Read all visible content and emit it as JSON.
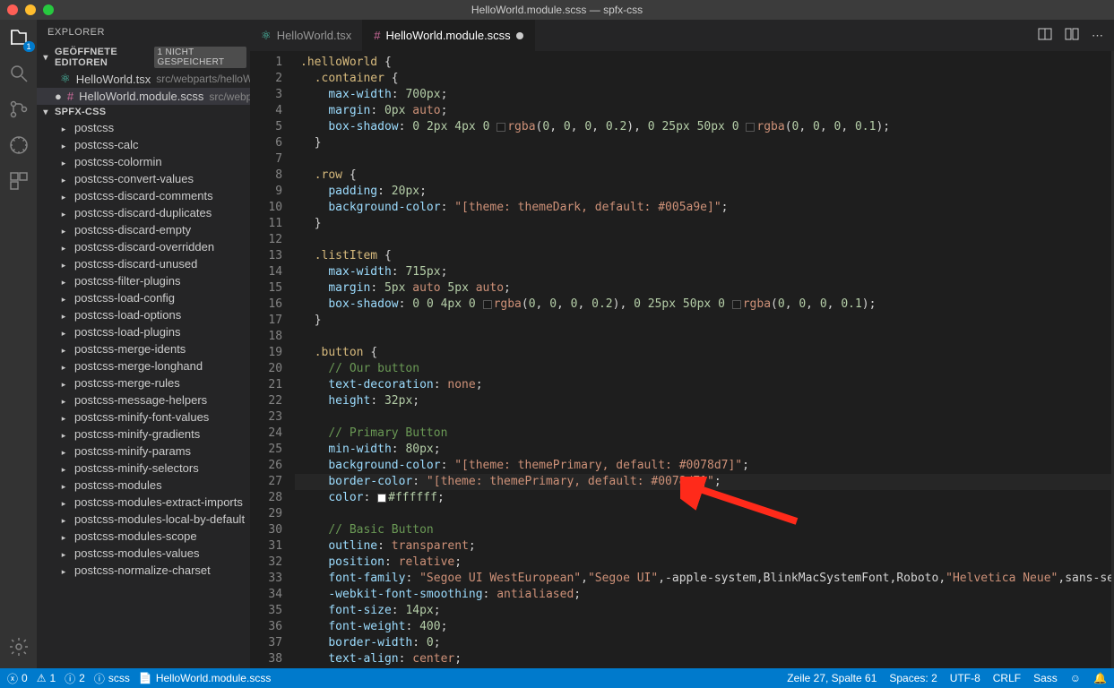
{
  "window": {
    "title": "HelloWorld.module.scss — spfx-css"
  },
  "activity_badge": "1",
  "sidebar": {
    "title": "EXPLORER",
    "open_editors_label": "GEÖFFNETE EDITOREN",
    "unsaved_badge": "1 NICHT GESPEICHERT",
    "project_label": "SPFX-CSS",
    "open_editors": [
      {
        "name": "HelloWorld.tsx",
        "path": "src/webparts/helloWor…",
        "dirty": false,
        "icon": "react"
      },
      {
        "name": "HelloWorld.module.scss",
        "path": "src/webpart…",
        "dirty": true,
        "icon": "sass"
      }
    ],
    "tree": [
      "postcss",
      "postcss-calc",
      "postcss-colormin",
      "postcss-convert-values",
      "postcss-discard-comments",
      "postcss-discard-duplicates",
      "postcss-discard-empty",
      "postcss-discard-overridden",
      "postcss-discard-unused",
      "postcss-filter-plugins",
      "postcss-load-config",
      "postcss-load-options",
      "postcss-load-plugins",
      "postcss-merge-idents",
      "postcss-merge-longhand",
      "postcss-merge-rules",
      "postcss-message-helpers",
      "postcss-minify-font-values",
      "postcss-minify-gradients",
      "postcss-minify-params",
      "postcss-minify-selectors",
      "postcss-modules",
      "postcss-modules-extract-imports",
      "postcss-modules-local-by-default",
      "postcss-modules-scope",
      "postcss-modules-values",
      "postcss-normalize-charset"
    ]
  },
  "tabs": [
    {
      "label": "HelloWorld.tsx",
      "icon": "react",
      "active": false,
      "dirty": false
    },
    {
      "label": "HelloWorld.module.scss",
      "icon": "sass",
      "active": true,
      "dirty": true
    }
  ],
  "code": {
    "first_line": 1,
    "lines": [
      "<span class='tk-class'>.helloWorld</span> <span class='tk-punct'>{</span>",
      "  <span class='tk-class'>.container</span> <span class='tk-punct'>{</span>",
      "    <span class='tk-prop'>max-width</span><span class='tk-punct'>:</span> <span class='tk-num'>700px</span><span class='tk-punct'>;</span>",
      "    <span class='tk-prop'>margin</span><span class='tk-punct'>:</span> <span class='tk-num'>0px</span> <span class='tk-kw'>auto</span><span class='tk-punct'>;</span>",
      "    <span class='tk-prop'>box-shadow</span><span class='tk-punct'>:</span> <span class='tk-num'>0</span> <span class='tk-num'>2px</span> <span class='tk-num'>4px</span> <span class='tk-num'>0</span> <span class='colorbox' style='background:rgba(0,0,0,0.2)'></span><span class='tk-func'>rgba</span><span class='tk-punct'>(</span><span class='tk-num'>0</span><span class='tk-punct'>,</span> <span class='tk-num'>0</span><span class='tk-punct'>,</span> <span class='tk-num'>0</span><span class='tk-punct'>,</span> <span class='tk-num'>0.2</span><span class='tk-punct'>),</span> <span class='tk-num'>0</span> <span class='tk-num'>25px</span> <span class='tk-num'>50px</span> <span class='tk-num'>0</span> <span class='colorbox' style='background:rgba(0,0,0,0.1)'></span><span class='tk-func'>rgba</span><span class='tk-punct'>(</span><span class='tk-num'>0</span><span class='tk-punct'>,</span> <span class='tk-num'>0</span><span class='tk-punct'>,</span> <span class='tk-num'>0</span><span class='tk-punct'>,</span> <span class='tk-num'>0.1</span><span class='tk-punct'>);</span>",
      "  <span class='tk-punct'>}</span>",
      "",
      "  <span class='tk-class'>.row</span> <span class='tk-punct'>{</span>",
      "    <span class='tk-prop'>padding</span><span class='tk-punct'>:</span> <span class='tk-num'>20px</span><span class='tk-punct'>;</span>",
      "    <span class='tk-prop'>background-color</span><span class='tk-punct'>:</span> <span class='tk-str'>\"[theme: themeDark, default: #005a9e]\"</span><span class='tk-punct'>;</span>",
      "  <span class='tk-punct'>}</span>",
      "",
      "  <span class='tk-class'>.listItem</span> <span class='tk-punct'>{</span>",
      "    <span class='tk-prop'>max-width</span><span class='tk-punct'>:</span> <span class='tk-num'>715px</span><span class='tk-punct'>;</span>",
      "    <span class='tk-prop'>margin</span><span class='tk-punct'>:</span> <span class='tk-num'>5px</span> <span class='tk-kw'>auto</span> <span class='tk-num'>5px</span> <span class='tk-kw'>auto</span><span class='tk-punct'>;</span>",
      "    <span class='tk-prop'>box-shadow</span><span class='tk-punct'>:</span> <span class='tk-num'>0</span> <span class='tk-num'>0</span> <span class='tk-num'>4px</span> <span class='tk-num'>0</span> <span class='colorbox' style='background:rgba(0,0,0,0.2)'></span><span class='tk-func'>rgba</span><span class='tk-punct'>(</span><span class='tk-num'>0</span><span class='tk-punct'>,</span> <span class='tk-num'>0</span><span class='tk-punct'>,</span> <span class='tk-num'>0</span><span class='tk-punct'>,</span> <span class='tk-num'>0.2</span><span class='tk-punct'>),</span> <span class='tk-num'>0</span> <span class='tk-num'>25px</span> <span class='tk-num'>50px</span> <span class='tk-num'>0</span> <span class='colorbox' style='background:rgba(0,0,0,0.1)'></span><span class='tk-func'>rgba</span><span class='tk-punct'>(</span><span class='tk-num'>0</span><span class='tk-punct'>,</span> <span class='tk-num'>0</span><span class='tk-punct'>,</span> <span class='tk-num'>0</span><span class='tk-punct'>,</span> <span class='tk-num'>0.1</span><span class='tk-punct'>);</span>",
      "  <span class='tk-punct'>}</span>",
      "",
      "  <span class='tk-class'>.button</span> <span class='tk-punct'>{</span>",
      "    <span class='tk-comment'>// Our button</span>",
      "    <span class='tk-prop'>text-decoration</span><span class='tk-punct'>:</span> <span class='tk-kw'>none</span><span class='tk-punct'>;</span>",
      "    <span class='tk-prop'>height</span><span class='tk-punct'>:</span> <span class='tk-num'>32px</span><span class='tk-punct'>;</span>",
      "",
      "    <span class='tk-comment'>// Primary Button</span>",
      "    <span class='tk-prop'>min-width</span><span class='tk-punct'>:</span> <span class='tk-num'>80px</span><span class='tk-punct'>;</span>",
      "    <span class='tk-prop'>background-color</span><span class='tk-punct'>:</span> <span class='tk-str'>\"[theme: themePrimary, default: #0078d7]\"</span><span class='tk-punct'>;</span>",
      "    <span class='tk-prop'>border-color</span><span class='tk-punct'>:</span> <span class='tk-str'>\"[theme: themePrimary, default: #0078d7]\"</span><span class='tk-punct'>;</span>",
      "    <span class='tk-prop'>color</span><span class='tk-punct'>:</span> <span class='colorbox' style='background:#ffffff'></span><span class='tk-num'>#ffffff</span><span class='tk-punct'>;</span>",
      "",
      "    <span class='tk-comment'>// Basic Button</span>",
      "    <span class='tk-prop'>outline</span><span class='tk-punct'>:</span> <span class='tk-kw'>transparent</span><span class='tk-punct'>;</span>",
      "    <span class='tk-prop'>position</span><span class='tk-punct'>:</span> <span class='tk-kw'>relative</span><span class='tk-punct'>;</span>",
      "    <span class='tk-prop'>font-family</span><span class='tk-punct'>:</span> <span class='tk-str'>\"Segoe UI WestEuropean\"</span><span class='tk-punct'>,</span><span class='tk-str'>\"Segoe UI\"</span><span class='tk-punct'>,</span><span class='tk-white'>-apple-system</span><span class='tk-punct'>,</span><span class='tk-white'>BlinkMacSystemFont</span><span class='tk-punct'>,</span><span class='tk-white'>Roboto</span><span class='tk-punct'>,</span><span class='tk-str'>\"Helvetica Neue\"</span><span class='tk-punct'>,</span><span class='tk-white'>sans-se</span>",
      "    <span class='tk-prop'>-webkit-font-smoothing</span><span class='tk-punct'>:</span> <span class='tk-kw'>antialiased</span><span class='tk-punct'>;</span>",
      "    <span class='tk-prop'>font-size</span><span class='tk-punct'>:</span> <span class='tk-num'>14px</span><span class='tk-punct'>;</span>",
      "    <span class='tk-prop'>font-weight</span><span class='tk-punct'>:</span> <span class='tk-num'>400</span><span class='tk-punct'>;</span>",
      "    <span class='tk-prop'>border-width</span><span class='tk-punct'>:</span> <span class='tk-num'>0</span><span class='tk-punct'>;</span>",
      "    <span class='tk-prop'>text-align</span><span class='tk-punct'>:</span> <span class='tk-kw'>center</span><span class='tk-punct'>;</span>"
    ],
    "highlight_line": 27
  },
  "status": {
    "errors": "0",
    "warnings": "1",
    "infos": "2",
    "scss": "scss",
    "filename": "HelloWorld.module.scss",
    "cursor": "Zeile 27, Spalte 61",
    "spaces": "Spaces: 2",
    "encoding": "UTF-8",
    "eol": "CRLF",
    "lang": "Sass"
  }
}
